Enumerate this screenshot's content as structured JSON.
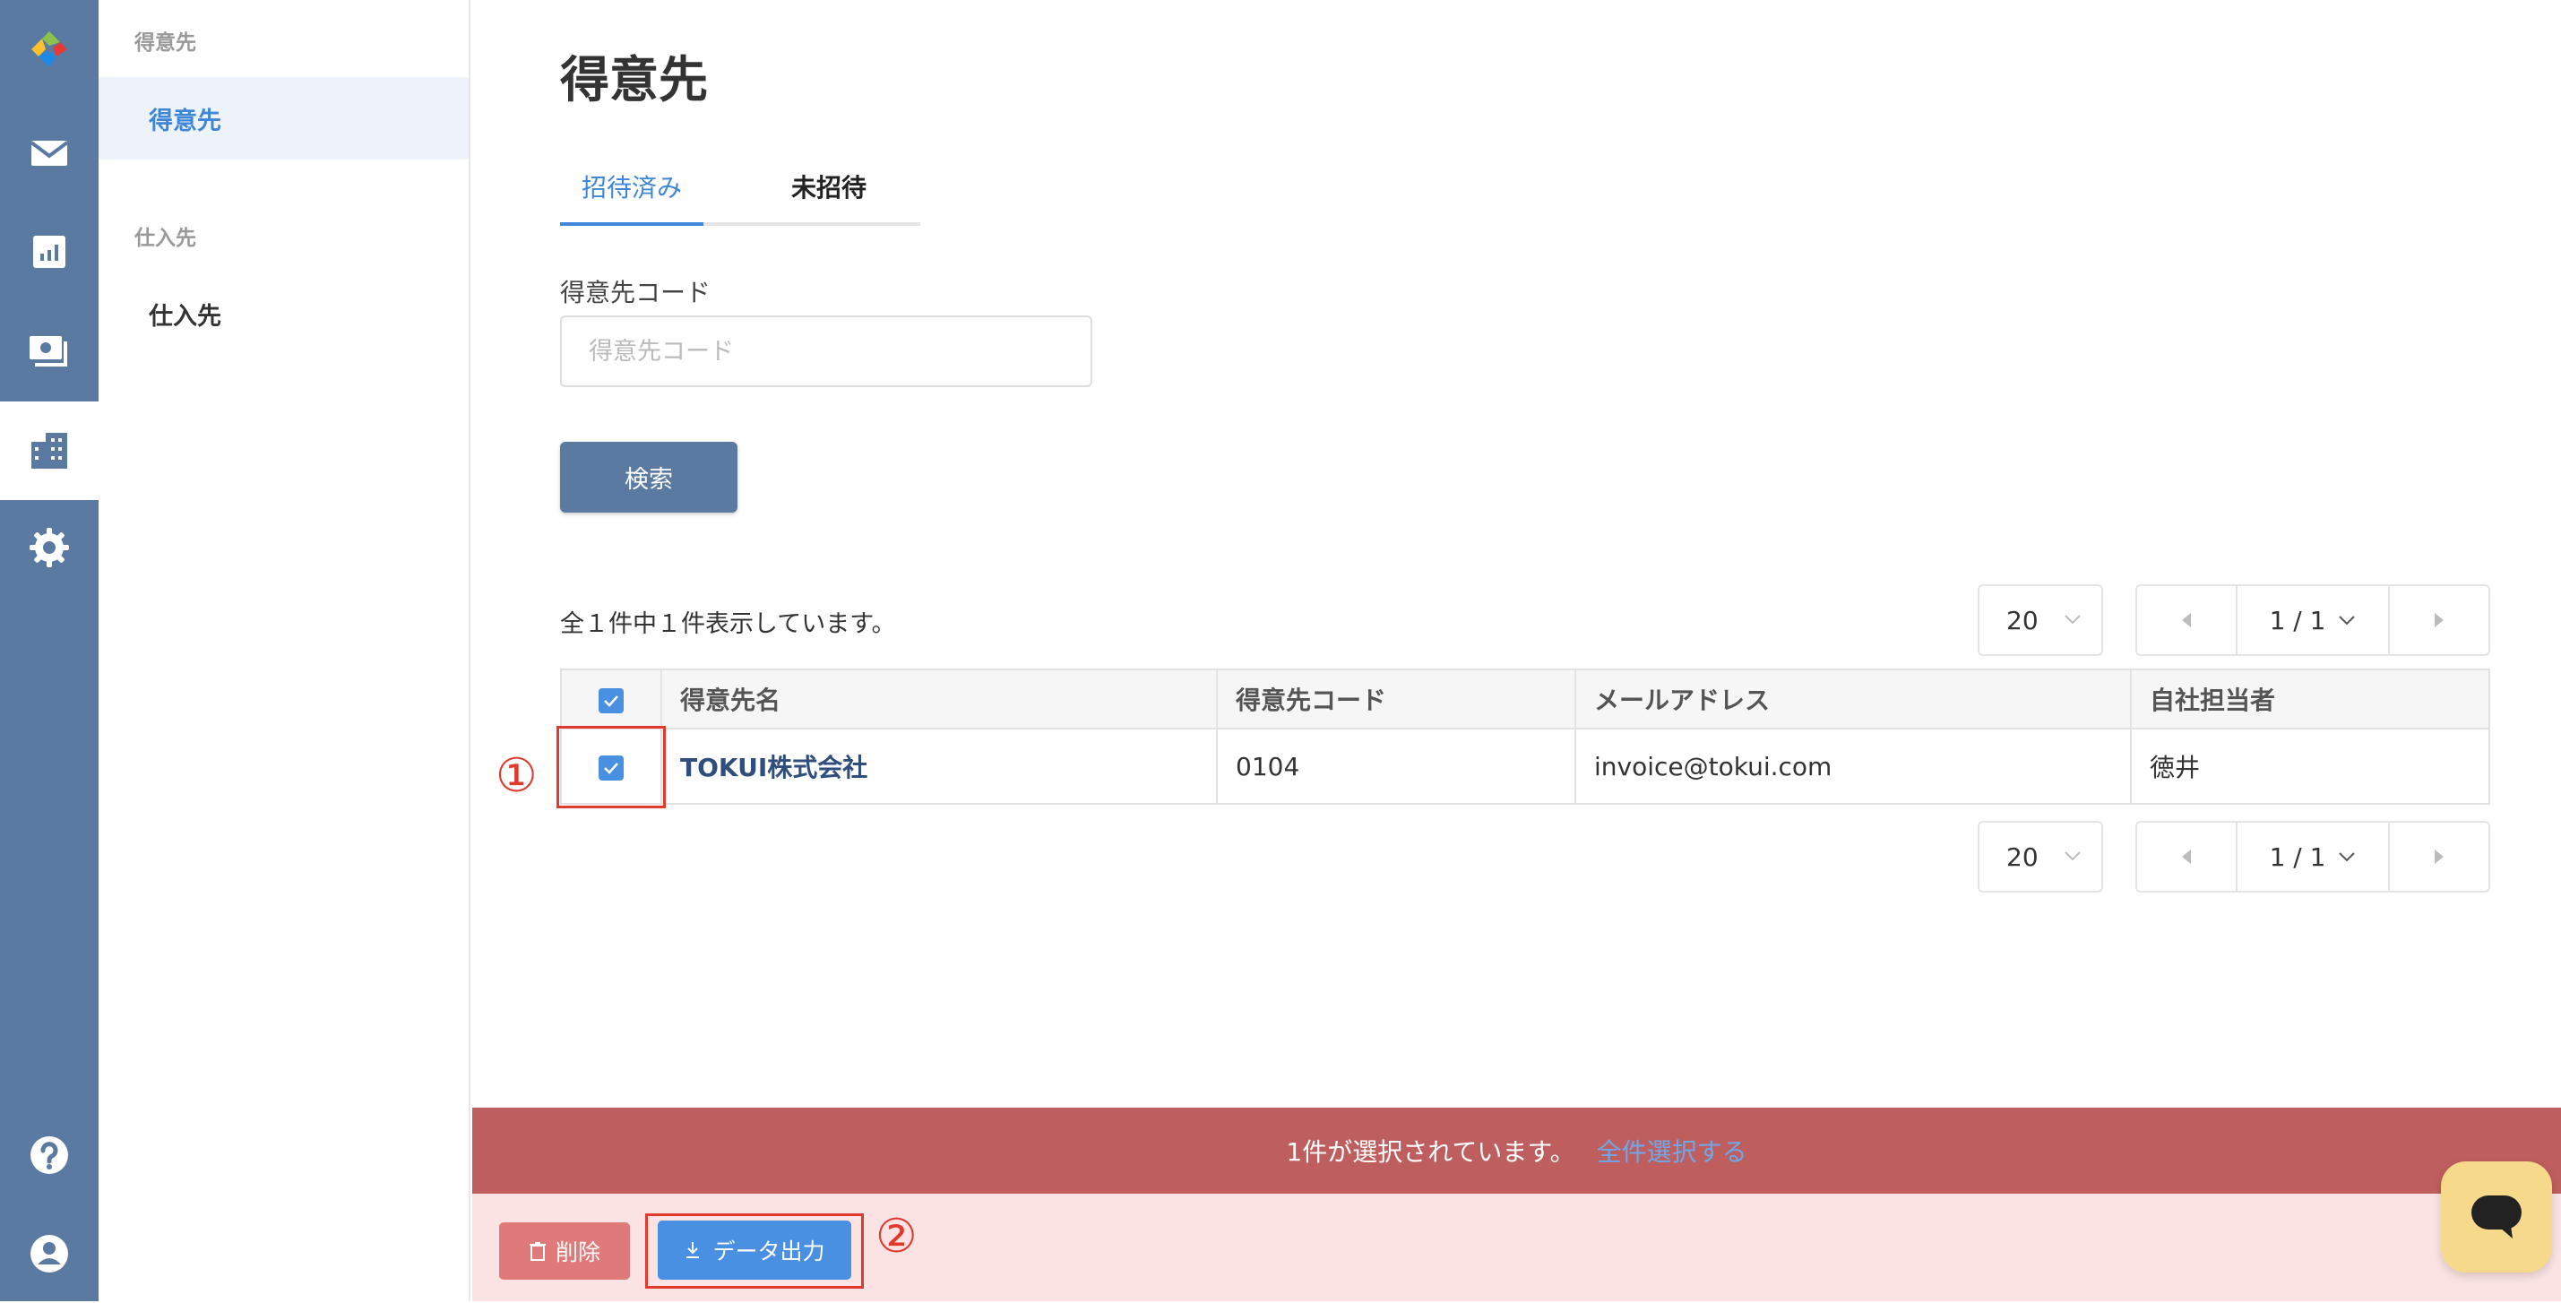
{
  "sidebar": {
    "groups": [
      {
        "title": "得意先",
        "items": [
          {
            "label": "得意先"
          }
        ]
      },
      {
        "title": "仕入先",
        "items": [
          {
            "label": "仕入先"
          }
        ]
      }
    ]
  },
  "main": {
    "title": "得意先",
    "tabs": [
      {
        "label": "招待済み",
        "active": true
      },
      {
        "label": "未招待",
        "active": false
      }
    ],
    "filter": {
      "label": "得意先コード",
      "placeholder": "得意先コード",
      "value": ""
    },
    "search_label": "検索",
    "count_text": "全１件中１件表示しています。",
    "pagination": {
      "page_size": "20",
      "page": "1 / 1"
    },
    "table": {
      "columns": [
        "得意先名",
        "得意先コード",
        "メールアドレス",
        "自社担当者"
      ],
      "rows": [
        {
          "name": "TOKUI株式会社",
          "code": "0104",
          "email": "invoice@tokui.com",
          "owner": "徳井",
          "checked": true
        }
      ]
    }
  },
  "annotations": {
    "one": "①",
    "two": "②"
  },
  "selection": {
    "text": "1件が選択されています。",
    "select_all": "全件選択する"
  },
  "actions": {
    "delete_label": "削除",
    "export_label": "データ出力"
  },
  "colors": {
    "accent": "#3e86d8",
    "rail": "#5b7aa2",
    "danger": "#bf5e5e"
  }
}
